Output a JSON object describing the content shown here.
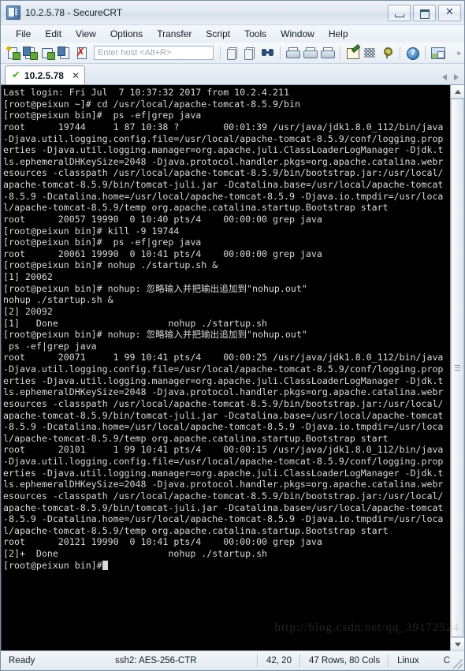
{
  "window": {
    "title": "10.2.5.78 - SecureCRT",
    "app_icon": "securecrt-icon",
    "minimize_label": "Minimize",
    "maximize_label": "Maximize",
    "close_label": "✕"
  },
  "menubar": {
    "items": [
      {
        "label": "File",
        "name": "menu-file"
      },
      {
        "label": "Edit",
        "name": "menu-edit"
      },
      {
        "label": "View",
        "name": "menu-view"
      },
      {
        "label": "Options",
        "name": "menu-options"
      },
      {
        "label": "Transfer",
        "name": "menu-transfer"
      },
      {
        "label": "Script",
        "name": "menu-script"
      },
      {
        "label": "Tools",
        "name": "menu-tools"
      },
      {
        "label": "Window",
        "name": "menu-window"
      },
      {
        "label": "Help",
        "name": "menu-help"
      }
    ]
  },
  "toolbar": {
    "host_placeholder": "Enter host <Alt+R>",
    "host_value": "",
    "overflow_label": "»",
    "icons": [
      "new-session-icon",
      "connect-sftp-icon",
      "connect-local-shell-icon",
      "reconnect-icon",
      "disconnect-icon",
      "copy-icon",
      "paste-icon",
      "find-icon",
      "print-icon",
      "print-selection-icon",
      "print-screen-icon",
      "log-session-icon",
      "session-options-icon",
      "key-manager-icon",
      "help-icon",
      "transfer-window-icon"
    ]
  },
  "tabs": {
    "items": [
      {
        "label": "10.2.5.78",
        "status_icon": "connected-check-icon",
        "close_label": "✕"
      }
    ],
    "prev_label": "◁",
    "next_label": "▷"
  },
  "terminal": {
    "rows": 47,
    "cols": 80,
    "lines": [
      "Last login: Fri Jul  7 10:37:32 2017 from 10.2.4.211",
      "[root@peixun ~]# cd /usr/local/apache-tomcat-8.5.9/bin",
      "[root@peixun bin]#  ps -ef|grep java",
      "root      19744     1 87 10:38 ?        00:01:39 /usr/java/jdk1.8.0_112/bin/java",
      "-Djava.util.logging.config.file=/usr/local/apache-tomcat-8.5.9/conf/logging.prop",
      "erties -Djava.util.logging.manager=org.apache.juli.ClassLoaderLogManager -Djdk.t",
      "ls.ephemeralDHKeySize=2048 -Djava.protocol.handler.pkgs=org.apache.catalina.webr",
      "esources -classpath /usr/local/apache-tomcat-8.5.9/bin/bootstrap.jar:/usr/local/",
      "apache-tomcat-8.5.9/bin/tomcat-juli.jar -Dcatalina.base=/usr/local/apache-tomcat",
      "-8.5.9 -Dcatalina.home=/usr/local/apache-tomcat-8.5.9 -Djava.io.tmpdir=/usr/loca",
      "l/apache-tomcat-8.5.9/temp org.apache.catalina.startup.Bootstrap start",
      "root      20057 19990  0 10:40 pts/4    00:00:00 grep java",
      "[root@peixun bin]# kill -9 19744",
      "[root@peixun bin]#  ps -ef|grep java",
      "root      20061 19990  0 10:41 pts/4    00:00:00 grep java",
      "[root@peixun bin]# nohup ./startup.sh &",
      "[1] 20062",
      "[root@peixun bin]# nohup: 忽略输入并把输出追加到\"nohup.out\"",
      "nohup ./startup.sh &",
      "[2] 20092",
      "[1]   Done                    nohup ./startup.sh",
      "[root@peixun bin]# nohup: 忽略输入并把输出追加到\"nohup.out\"",
      " ps -ef|grep java",
      "root      20071     1 99 10:41 pts/4    00:00:25 /usr/java/jdk1.8.0_112/bin/java",
      "-Djava.util.logging.config.file=/usr/local/apache-tomcat-8.5.9/conf/logging.prop",
      "erties -Djava.util.logging.manager=org.apache.juli.ClassLoaderLogManager -Djdk.t",
      "ls.ephemeralDHKeySize=2048 -Djava.protocol.handler.pkgs=org.apache.catalina.webr",
      "esources -classpath /usr/local/apache-tomcat-8.5.9/bin/bootstrap.jar:/usr/local/",
      "apache-tomcat-8.5.9/bin/tomcat-juli.jar -Dcatalina.base=/usr/local/apache-tomcat",
      "-8.5.9 -Dcatalina.home=/usr/local/apache-tomcat-8.5.9 -Djava.io.tmpdir=/usr/loca",
      "l/apache-tomcat-8.5.9/temp org.apache.catalina.startup.Bootstrap start",
      "root      20101     1 99 10:41 pts/4    00:00:15 /usr/java/jdk1.8.0_112/bin/java",
      "-Djava.util.logging.config.file=/usr/local/apache-tomcat-8.5.9/conf/logging.prop",
      "erties -Djava.util.logging.manager=org.apache.juli.ClassLoaderLogManager -Djdk.t",
      "ls.ephemeralDHKeySize=2048 -Djava.protocol.handler.pkgs=org.apache.catalina.webr",
      "esources -classpath /usr/local/apache-tomcat-8.5.9/bin/bootstrap.jar:/usr/local/",
      "apache-tomcat-8.5.9/bin/tomcat-juli.jar -Dcatalina.base=/usr/local/apache-tomcat",
      "-8.5.9 -Dcatalina.home=/usr/local/apache-tomcat-8.5.9 -Djava.io.tmpdir=/usr/loca",
      "l/apache-tomcat-8.5.9/temp org.apache.catalina.startup.Bootstrap start",
      "root      20121 19990  0 10:41 pts/4    00:00:00 grep java",
      "[2]+  Done                    nohup ./startup.sh",
      "[root@peixun bin]#"
    ],
    "scrollbar": {
      "up_label": "▲",
      "down_label": "▼"
    }
  },
  "watermark": {
    "text": "http://blog.csdn.net/qq_39172524"
  },
  "statusbar": {
    "ready": "Ready",
    "cipher": "ssh2: AES-256-CTR",
    "cursor": "42, 20",
    "size": "47 Rows, 80 Cols",
    "emulation": "Linux",
    "caps": "C"
  }
}
